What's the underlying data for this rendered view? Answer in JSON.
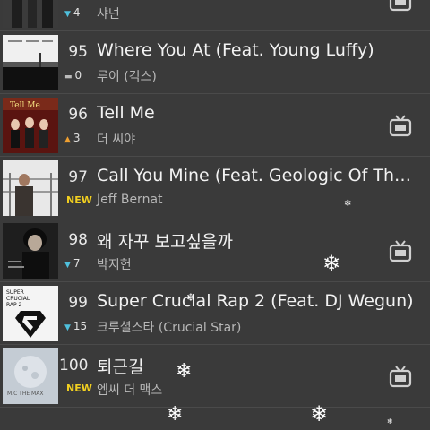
{
  "chart_list": {
    "rows": [
      {
        "rank": "",
        "change": "4",
        "change_dir": "down",
        "title": "",
        "artist": "샤넌",
        "has_mv": true
      },
      {
        "rank": "95",
        "change": "0",
        "change_dir": "same",
        "title": "Where You At (Feat. Young Luffy)",
        "artist": "루이 (긱스)",
        "has_mv": false
      },
      {
        "rank": "96",
        "change": "3",
        "change_dir": "up",
        "title": "Tell Me",
        "artist": "더 씨야",
        "has_mv": true
      },
      {
        "rank": "97",
        "change": "NEW",
        "change_dir": "new",
        "title": "Call You Mine (Feat. Geologic Of The…",
        "artist": "Jeff Bernat",
        "has_mv": false
      },
      {
        "rank": "98",
        "change": "7",
        "change_dir": "down",
        "title": "왜 자꾸 보고싶을까",
        "artist": "박지헌",
        "has_mv": true
      },
      {
        "rank": "99",
        "change": "15",
        "change_dir": "down",
        "title": "Super Crucial Rap 2 (Feat. DJ Wegun)",
        "artist": "크루셜스타 (Crucial Star)",
        "has_mv": false
      },
      {
        "rank": "100",
        "change": "NEW",
        "change_dir": "new",
        "title": "퇴근길",
        "artist": "엠씨 더 맥스",
        "has_mv": true
      }
    ]
  },
  "album_art": {
    "tell_me_text": "Tell Me",
    "super_text_1": "SUPER",
    "super_text_2": "CRUCIAL",
    "super_text_3": "RAP 2",
    "mc_the_max_text": "M.C THE MAX"
  },
  "colors": {
    "background": "#3a3a3a",
    "divider": "#4a4a4a",
    "down": "#4fc0dc",
    "up": "#f0a030",
    "new": "#f2d020"
  }
}
